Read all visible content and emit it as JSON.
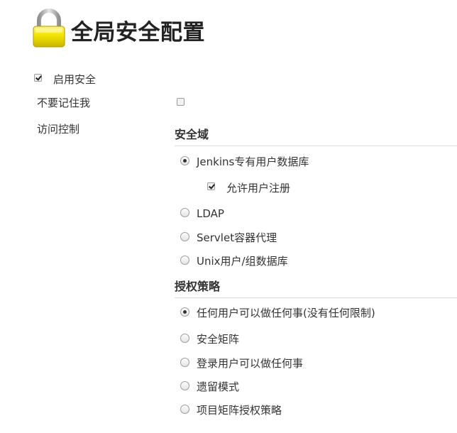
{
  "page": {
    "title": "全局安全配置"
  },
  "options": {
    "enable_security": {
      "label": "启用安全",
      "checked": true
    },
    "dont_remember_me": {
      "label": "不要记住我",
      "checked": false
    },
    "access_control": {
      "label": "访问控制"
    }
  },
  "security_realm": {
    "header": "安全域",
    "options": [
      {
        "label": "Jenkins专有用户数据库",
        "selected": true
      },
      {
        "label": "LDAP",
        "selected": false
      },
      {
        "label": "Servlet容器代理",
        "selected": false
      },
      {
        "label": "Unix用户/组数据库",
        "selected": false
      }
    ],
    "allow_signup": {
      "label": "允许用户注册",
      "checked": true
    }
  },
  "authorization": {
    "header": "授权策略",
    "options": [
      {
        "label": "任何用户可以做任何事(没有任何限制)",
        "selected": true
      },
      {
        "label": "安全矩阵",
        "selected": false
      },
      {
        "label": "登录用户可以做任何事",
        "selected": false
      },
      {
        "label": "遗留模式",
        "selected": false
      },
      {
        "label": "项目矩阵授权策略",
        "selected": false
      }
    ]
  },
  "colors": {
    "lock_body": "#f2e500",
    "lock_shackle": "#a8a8a8",
    "text": "#333333",
    "rule": "#dcdcdc"
  },
  "icons": {
    "title_icon": "lock-icon"
  }
}
